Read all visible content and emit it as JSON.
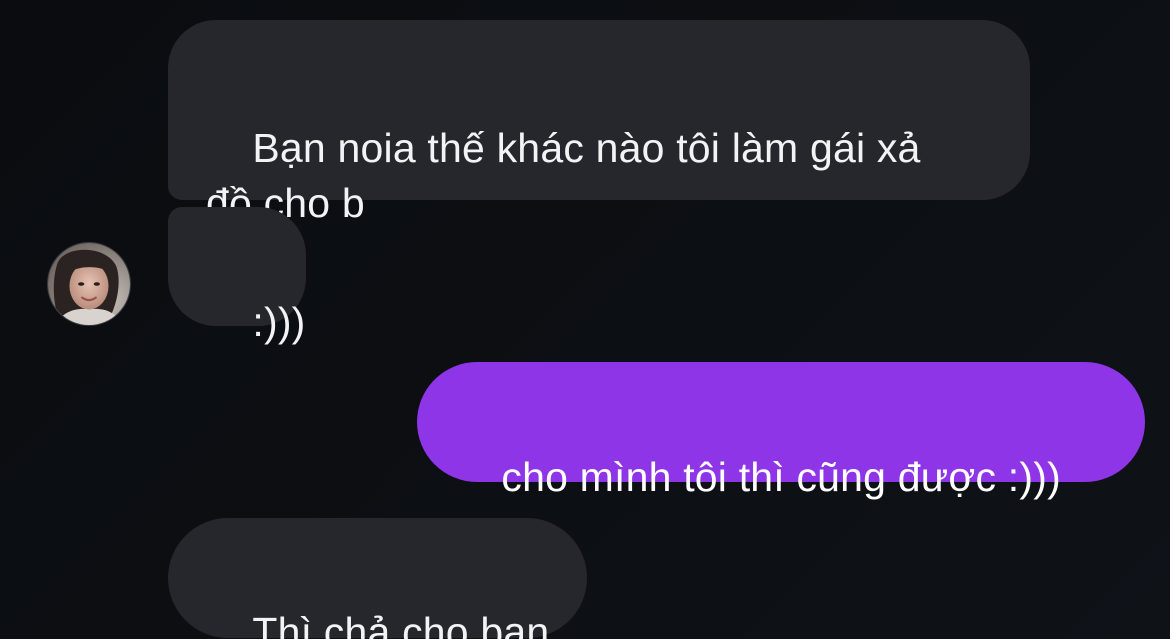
{
  "conversation": {
    "messages": [
      {
        "sender": "other",
        "text": "Bạn noia thế khác nào tôi làm gái xả\nđồ cho b"
      },
      {
        "sender": "other",
        "text": ":)))"
      },
      {
        "sender": "me",
        "text": "cho mình tôi thì cũng được :)))"
      },
      {
        "sender": "other",
        "text": "Thì chả cho bạn"
      }
    ]
  },
  "colors": {
    "background": "#0b0d11",
    "incoming_bubble": "#25272c",
    "outgoing_bubble": "#8f35e8",
    "text": "#f2f3f5"
  },
  "contact": {
    "avatar_icon": "profile-photo"
  }
}
